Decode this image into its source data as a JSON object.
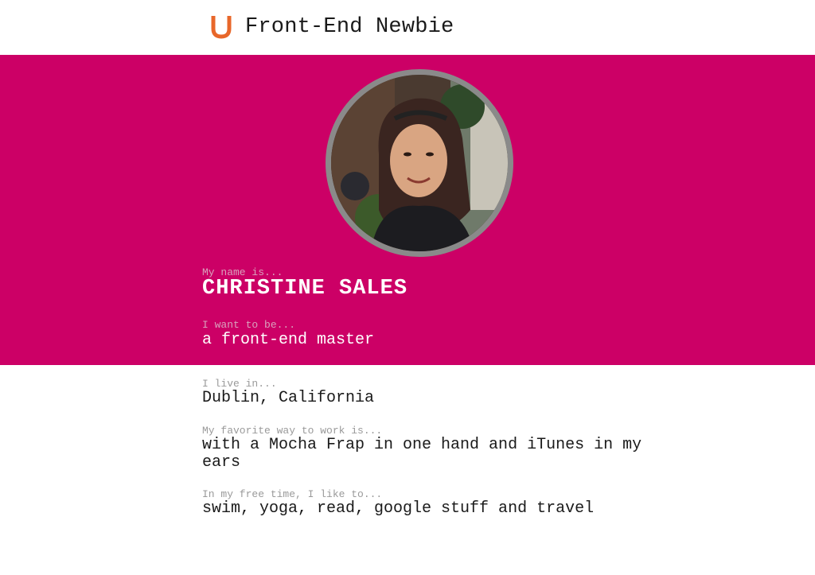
{
  "header": {
    "logo_icon": "u-logo-icon",
    "title": "Front-End Newbie"
  },
  "hero": {
    "background": "#cc0066",
    "avatar_icon": "profile-photo",
    "name_label": "My name is...",
    "name_value": "CHRISTINE SALES",
    "goal_label": "I want to be...",
    "goal_value": "a front-end master"
  },
  "about": {
    "location_label": "I live in...",
    "location_value": "Dublin, California",
    "work_label": "My favorite way to work is...",
    "work_value_line1": "with a Mocha Frap in one hand and iTunes in my",
    "work_value_line2": "ears",
    "free_time_label": "In my free time, I like to...",
    "free_time_value": "swim, yoga, read, google stuff and travel"
  },
  "colors": {
    "accent": "#cc0066",
    "logo": "#e8672a"
  }
}
